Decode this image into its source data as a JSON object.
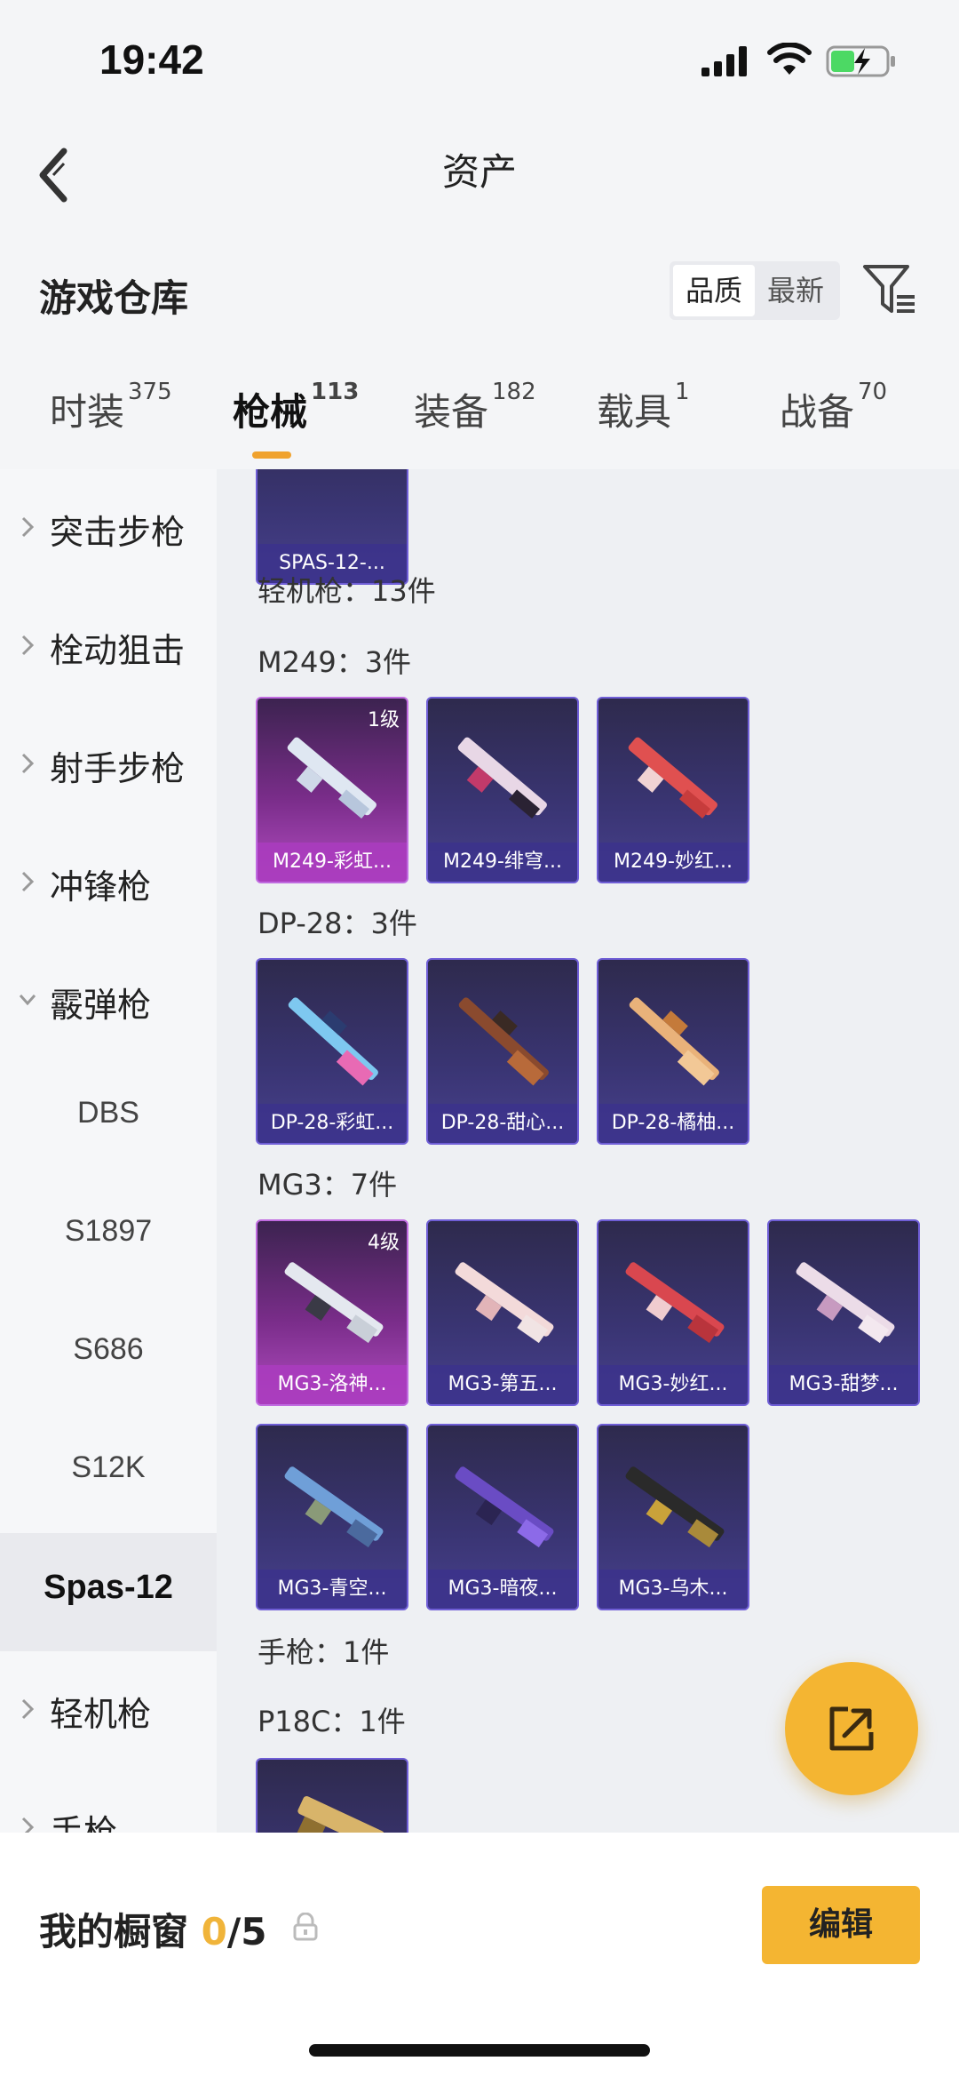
{
  "status": {
    "time": "19:42"
  },
  "nav": {
    "title": "资产"
  },
  "warehouse": {
    "label": "游戏仓库",
    "sort": [
      "品质",
      "最新"
    ]
  },
  "tabs": [
    {
      "label": "时装",
      "count": "375"
    },
    {
      "label": "枪械",
      "count": "113"
    },
    {
      "label": "装备",
      "count": "182"
    },
    {
      "label": "载具",
      "count": "1"
    },
    {
      "label": "战备",
      "count": "70"
    }
  ],
  "sidebar": {
    "items": [
      {
        "label": "突击步枪"
      },
      {
        "label": "栓动狙击"
      },
      {
        "label": "射手步枪"
      },
      {
        "label": "冲锋枪"
      },
      {
        "label": "霰弹枪"
      },
      {
        "label": "DBS"
      },
      {
        "label": "S1897"
      },
      {
        "label": "S686"
      },
      {
        "label": "S12K"
      },
      {
        "label": "Spas-12"
      },
      {
        "label": "轻机枪"
      },
      {
        "label": "手枪"
      }
    ]
  },
  "content": {
    "top_card": "SPAS-12-...",
    "lmg_header": "轻机枪：13件",
    "m249_header": "M249：3件",
    "m249": [
      {
        "label": "M249-彩虹...",
        "level": "1级"
      },
      {
        "label": "M249-绯穹..."
      },
      {
        "label": "M249-妙红..."
      }
    ],
    "dp28_header": "DP-28：3件",
    "dp28": [
      {
        "label": "DP-28-彩虹..."
      },
      {
        "label": "DP-28-甜心..."
      },
      {
        "label": "DP-28-橘柚..."
      }
    ],
    "mg3_header": "MG3：7件",
    "mg3": [
      {
        "label": "MG3-洛神...",
        "level": "4级"
      },
      {
        "label": "MG3-第五..."
      },
      {
        "label": "MG3-妙红..."
      },
      {
        "label": "MG3-甜梦..."
      },
      {
        "label": "MG3-青空..."
      },
      {
        "label": "MG3-暗夜..."
      },
      {
        "label": "MG3-乌木..."
      }
    ],
    "pistol_header": "手枪：1件",
    "p18c_header": "P18C：1件"
  },
  "bottom": {
    "label": "我的橱窗",
    "count": "0",
    "total": "/5",
    "edit": "编辑"
  },
  "colors": {
    "accent": "#f4b532",
    "card_purple": "#3a3574",
    "card_pink": "#b24cc1"
  }
}
